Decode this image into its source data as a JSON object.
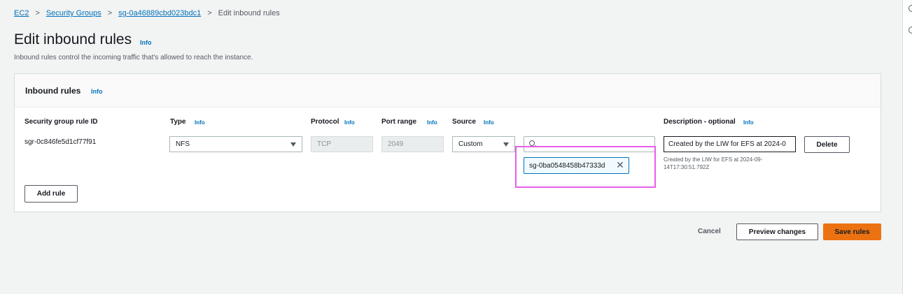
{
  "breadcrumb": {
    "items": [
      "EC2",
      "Security Groups",
      "sg-0a46889cbd023bdc1"
    ],
    "current": "Edit inbound rules",
    "separator": ">"
  },
  "page": {
    "title": "Edit inbound rules",
    "info": "Info",
    "description": "Inbound rules control the incoming traffic that's allowed to reach the instance."
  },
  "panel": {
    "title": "Inbound rules",
    "info": "Info"
  },
  "columns": {
    "rule_id": "Security group rule ID",
    "type": "Type",
    "protocol": "Protocol",
    "port_range": "Port range",
    "source": "Source",
    "description": "Description - optional",
    "info": "Info"
  },
  "rule": {
    "id": "sgr-0c846fe5d1cf77f91",
    "type": "NFS",
    "protocol": "TCP",
    "port_range": "2049",
    "source": "Custom",
    "source_search": "",
    "source_token": "sg-0ba0548458b47333d",
    "description": "Created by the LIW for EFS at 2024-0",
    "description_help": "Created by the LIW for EFS at 2024-09-14T17:30:51.792Z",
    "delete_label": "Delete"
  },
  "actions": {
    "add_rule": "Add rule",
    "cancel": "Cancel",
    "preview": "Preview changes",
    "save": "Save rules"
  },
  "colors": {
    "link": "#0073bb",
    "primary_button": "#ec7211",
    "highlight": "#e85fe8"
  }
}
